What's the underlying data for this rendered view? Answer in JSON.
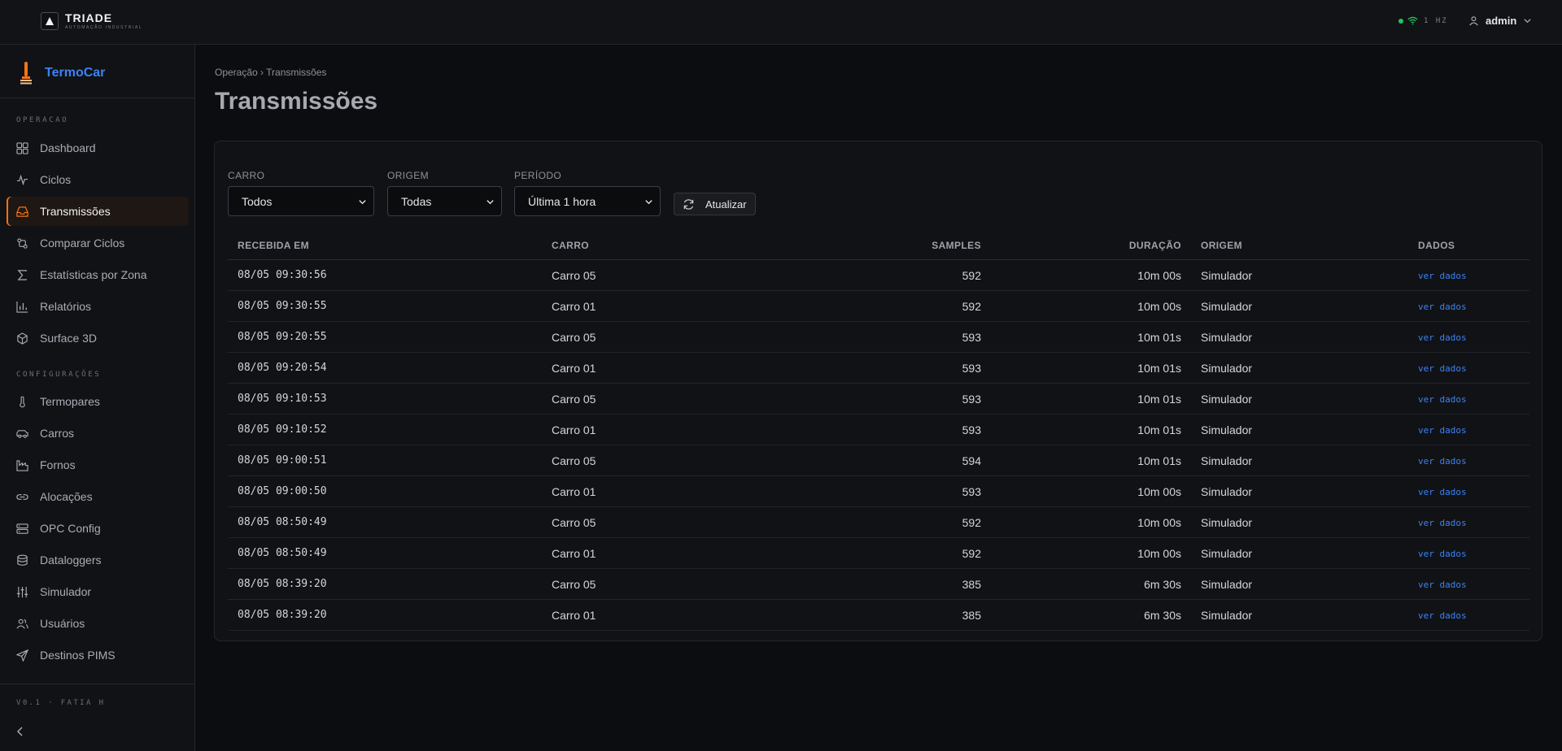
{
  "topbar": {
    "brand_name": "TRIADE",
    "brand_sub": "AUTOMAÇÃO INDUSTRIAL",
    "status_text": "1 HZ",
    "user_name": "admin"
  },
  "sidebar": {
    "app_name": "TermoCar",
    "section_operacao": "OPERACAO",
    "section_config": "CONFIGURAÇÕES",
    "items": [
      {
        "label": "Dashboard"
      },
      {
        "label": "Ciclos"
      },
      {
        "label": "Transmissões"
      },
      {
        "label": "Comparar Ciclos"
      },
      {
        "label": "Estatísticas por Zona"
      },
      {
        "label": "Relatórios"
      },
      {
        "label": "Surface 3D"
      },
      {
        "label": "Termopares"
      },
      {
        "label": "Carros"
      },
      {
        "label": "Fornos"
      },
      {
        "label": "Alocações"
      },
      {
        "label": "OPC Config"
      },
      {
        "label": "Dataloggers"
      },
      {
        "label": "Simulador"
      },
      {
        "label": "Usuários"
      },
      {
        "label": "Destinos PIMS"
      }
    ],
    "version": "V0.1 · FATIA H"
  },
  "main": {
    "breadcrumb": "Operação › Transmissões",
    "title": "Transmissões",
    "filters": {
      "carro_label": "CARRO",
      "carro_value": "Todos",
      "origem_label": "ORIGEM",
      "origem_value": "Todas",
      "periodo_label": "PERÍODO",
      "periodo_value": "Última 1 hora",
      "refresh_label": "Atualizar"
    },
    "table": {
      "headers": [
        "RECEBIDA EM",
        "CARRO",
        "SAMPLES",
        "DURAÇÃO",
        "ORIGEM",
        "DADOS"
      ],
      "rows": [
        {
          "received": "08/05 09:30:56",
          "car": "Carro 05",
          "samples": "592",
          "duration": "10m 00s",
          "origin": "Simulador",
          "data": "ver dados"
        },
        {
          "received": "08/05 09:30:55",
          "car": "Carro 01",
          "samples": "592",
          "duration": "10m 00s",
          "origin": "Simulador",
          "data": "ver dados"
        },
        {
          "received": "08/05 09:20:55",
          "car": "Carro 05",
          "samples": "593",
          "duration": "10m 01s",
          "origin": "Simulador",
          "data": "ver dados"
        },
        {
          "received": "08/05 09:20:54",
          "car": "Carro 01",
          "samples": "593",
          "duration": "10m 01s",
          "origin": "Simulador",
          "data": "ver dados"
        },
        {
          "received": "08/05 09:10:53",
          "car": "Carro 05",
          "samples": "593",
          "duration": "10m 01s",
          "origin": "Simulador",
          "data": "ver dados"
        },
        {
          "received": "08/05 09:10:52",
          "car": "Carro 01",
          "samples": "593",
          "duration": "10m 01s",
          "origin": "Simulador",
          "data": "ver dados"
        },
        {
          "received": "08/05 09:00:51",
          "car": "Carro 05",
          "samples": "594",
          "duration": "10m 01s",
          "origin": "Simulador",
          "data": "ver dados"
        },
        {
          "received": "08/05 09:00:50",
          "car": "Carro 01",
          "samples": "593",
          "duration": "10m 00s",
          "origin": "Simulador",
          "data": "ver dados"
        },
        {
          "received": "08/05 08:50:49",
          "car": "Carro 05",
          "samples": "592",
          "duration": "10m 00s",
          "origin": "Simulador",
          "data": "ver dados"
        },
        {
          "received": "08/05 08:50:49",
          "car": "Carro 01",
          "samples": "592",
          "duration": "10m 00s",
          "origin": "Simulador",
          "data": "ver dados"
        },
        {
          "received": "08/05 08:39:20",
          "car": "Carro 05",
          "samples": "385",
          "duration": "6m 30s",
          "origin": "Simulador",
          "data": "ver dados"
        },
        {
          "received": "08/05 08:39:20",
          "car": "Carro 01",
          "samples": "385",
          "duration": "6m 30s",
          "origin": "Simulador",
          "data": "ver dados"
        }
      ]
    }
  },
  "colors": {
    "accent": "#f97316",
    "link": "#3b82f6",
    "status_ok": "#22c55e"
  },
  "icons": {
    "brand": "triangle-logo-icon",
    "app": "thermometer-flame-icon",
    "status": "wifi-icon",
    "user": "user-icon"
  }
}
